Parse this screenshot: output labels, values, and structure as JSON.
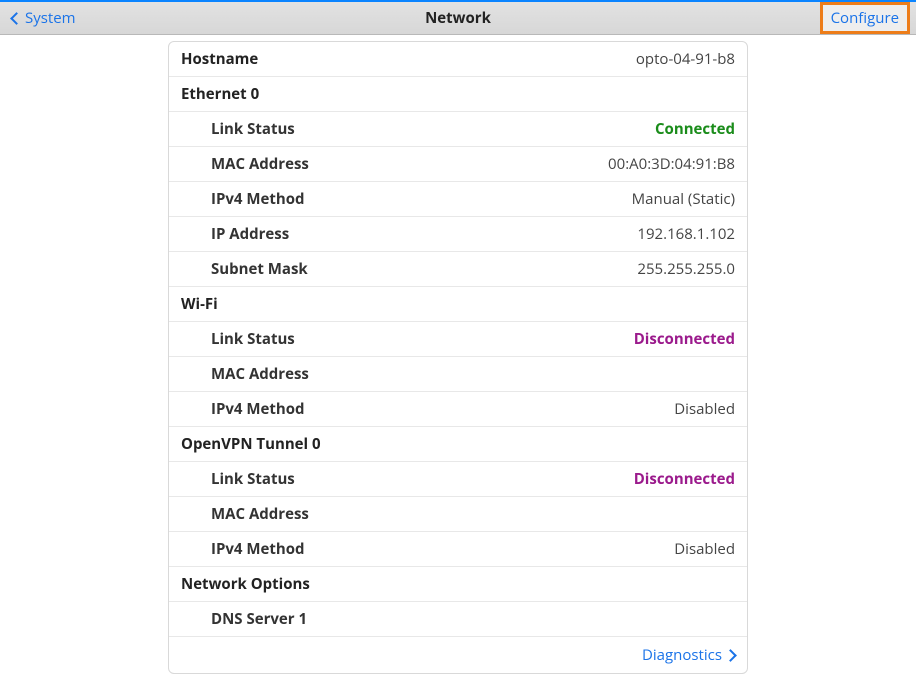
{
  "header": {
    "back_label": "System",
    "title": "Network",
    "configure_label": "Configure"
  },
  "hostname": {
    "label": "Hostname",
    "value": "opto-04-91-b8"
  },
  "ethernet0": {
    "title": "Ethernet 0",
    "link_status_label": "Link Status",
    "link_status_value": "Connected",
    "mac_label": "MAC Address",
    "mac_value": "00:A0:3D:04:91:B8",
    "ipv4_method_label": "IPv4 Method",
    "ipv4_method_value": "Manual (Static)",
    "ip_label": "IP Address",
    "ip_value": "192.168.1.102",
    "subnet_label": "Subnet Mask",
    "subnet_value": "255.255.255.0"
  },
  "wifi": {
    "title": "Wi-Fi",
    "link_status_label": "Link Status",
    "link_status_value": "Disconnected",
    "mac_label": "MAC Address",
    "mac_value": "",
    "ipv4_method_label": "IPv4 Method",
    "ipv4_method_value": "Disabled"
  },
  "openvpn0": {
    "title": "OpenVPN Tunnel 0",
    "link_status_label": "Link Status",
    "link_status_value": "Disconnected",
    "mac_label": "MAC Address",
    "mac_value": "",
    "ipv4_method_label": "IPv4 Method",
    "ipv4_method_value": "Disabled"
  },
  "network_options": {
    "title": "Network Options",
    "dns1_label": "DNS Server 1",
    "dns1_value": ""
  },
  "footer": {
    "diagnostics_label": "Diagnostics"
  }
}
